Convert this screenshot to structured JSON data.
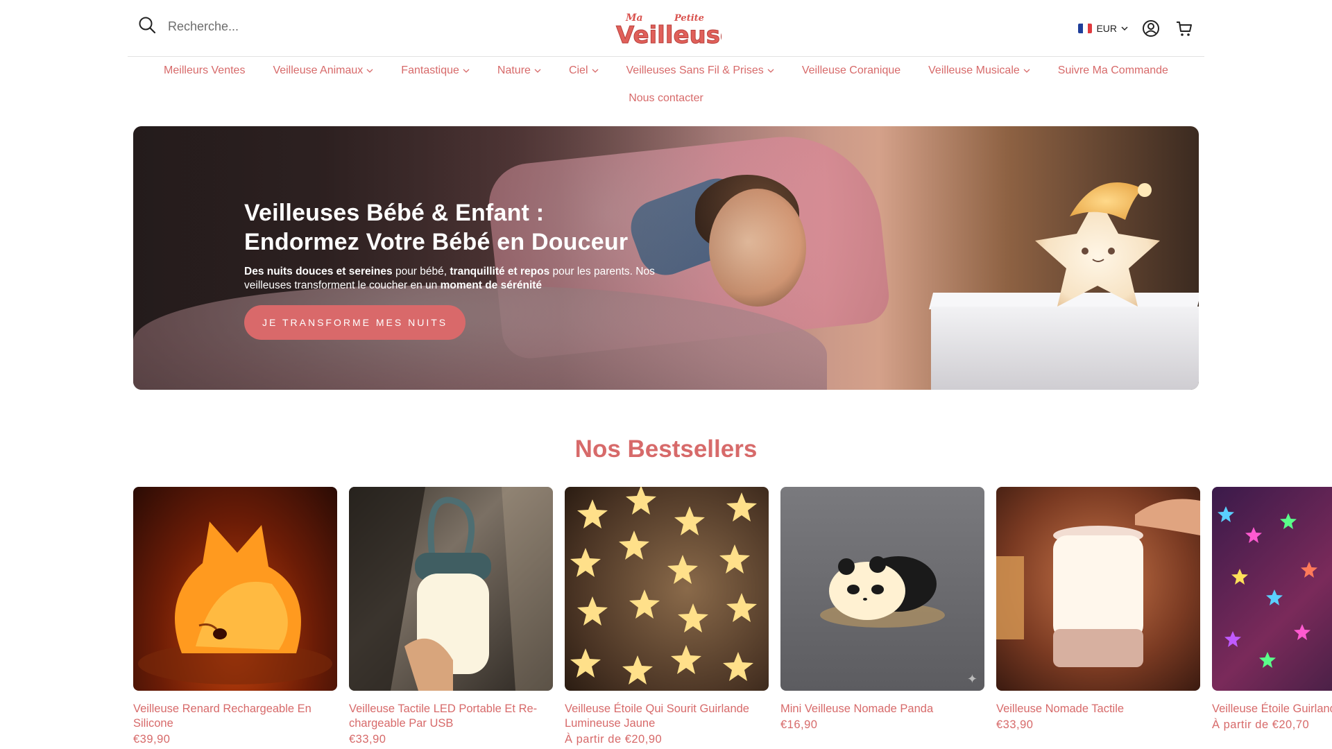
{
  "header": {
    "search_placeholder": "Recherche...",
    "logo_alt": "Ma Petite Veilleuse",
    "currency": "EUR"
  },
  "nav": {
    "items": [
      {
        "label": "Meilleurs Ventes",
        "dropdown": false
      },
      {
        "label": "Veilleuse Animaux",
        "dropdown": true
      },
      {
        "label": "Fantastique",
        "dropdown": true
      },
      {
        "label": "Nature",
        "dropdown": true
      },
      {
        "label": "Ciel",
        "dropdown": true
      },
      {
        "label": "Veilleuses Sans Fil & Prises",
        "dropdown": true
      },
      {
        "label": "Veilleuse Coranique",
        "dropdown": false
      },
      {
        "label": "Veilleuse Musicale",
        "dropdown": true
      },
      {
        "label": "Suivre Ma Commande",
        "dropdown": false
      },
      {
        "label": "Nous contacter",
        "dropdown": false
      }
    ]
  },
  "hero": {
    "title_line1": "Veilleuses Bébé & Enfant :",
    "title_line2": "Endormez Votre Bébé en Douceur",
    "desc_b1": "Des nuits douces et sereines",
    "desc_t1": " pour bébé, ",
    "desc_b2": "tranquillité et repos",
    "desc_t2": " pour les parents. Nos veilleuses transforment le coucher en un ",
    "desc_b3": "moment de sérénité",
    "cta": "JE TRANSFORME MES NUITS"
  },
  "bestsellers": {
    "title": "Nos Bestsellers",
    "products": [
      {
        "name": "Veilleuse Renard Rechargeable En Silicone",
        "price": "€39,90"
      },
      {
        "name": "Veilleuse Tactile LED Portable Et Re-chargeable Par USB",
        "price": "€33,90"
      },
      {
        "name": "Veilleuse Étoile Qui Sourit Guirlande Lumineuse Jaune",
        "price": "À partir de €20,90"
      },
      {
        "name": "Mini Veilleuse Nomade Panda",
        "price": "€16,90"
      },
      {
        "name": "Veilleuse Nomade Tactile",
        "price": "€33,90"
      },
      {
        "name": "Veilleuse Étoile Guirlande Multicolore",
        "price": "À partir de €20,70"
      }
    ]
  },
  "colors": {
    "accent": "#d76a6a",
    "button": "#d9696a"
  }
}
